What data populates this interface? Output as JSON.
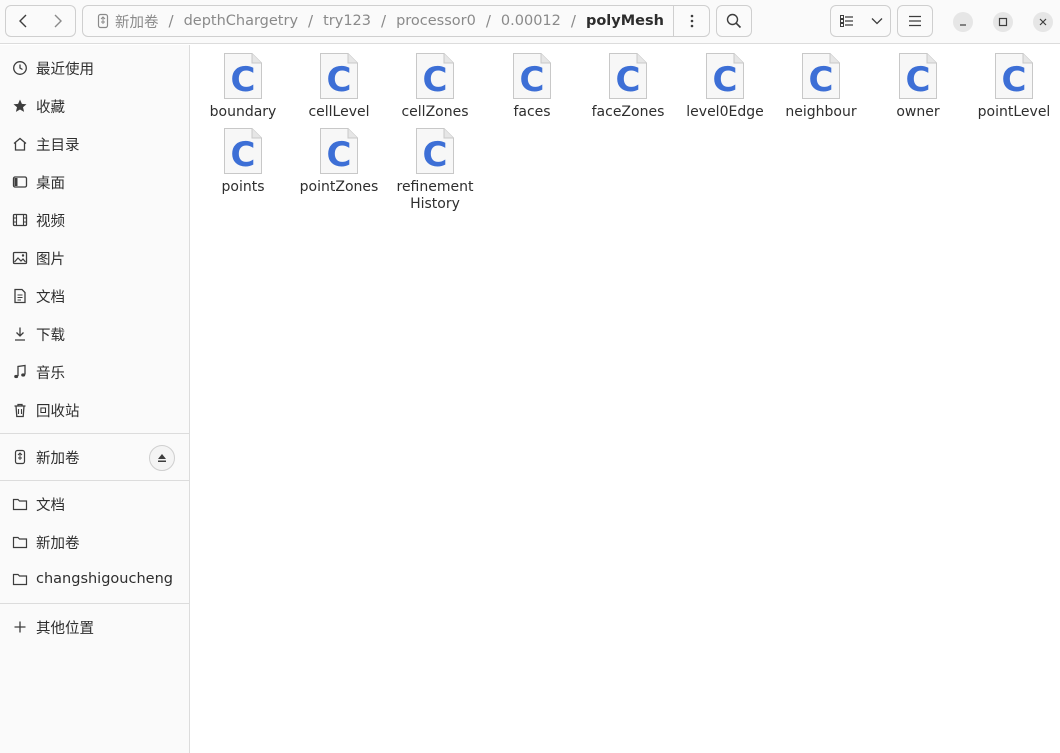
{
  "header": {
    "path": [
      "新加卷",
      "depthChargetry",
      "try123",
      "processor0",
      "0.00012",
      "polyMesh"
    ],
    "path_separator": "/"
  },
  "sidebar": {
    "places": [
      {
        "label": "最近使用",
        "icon": "clock-icon"
      },
      {
        "label": "收藏",
        "icon": "star-icon"
      },
      {
        "label": "主目录",
        "icon": "home-icon"
      },
      {
        "label": "桌面",
        "icon": "desktop-icon"
      },
      {
        "label": "视频",
        "icon": "video-icon"
      },
      {
        "label": "图片",
        "icon": "picture-icon"
      },
      {
        "label": "文档",
        "icon": "document-icon"
      },
      {
        "label": "下载",
        "icon": "download-icon"
      },
      {
        "label": "音乐",
        "icon": "music-icon"
      },
      {
        "label": "回收站",
        "icon": "trash-icon"
      }
    ],
    "devices": [
      {
        "label": "新加卷",
        "icon": "usb-drive-icon"
      }
    ],
    "bookmarks": [
      {
        "label": "文档",
        "icon": "folder-icon"
      },
      {
        "label": "新加卷",
        "icon": "folder-icon"
      },
      {
        "label": "changshigoucheng",
        "icon": "folder-icon"
      }
    ],
    "other": {
      "label": "其他位置",
      "icon": "plus-icon"
    }
  },
  "files": [
    {
      "name_lines": [
        "boundary"
      ]
    },
    {
      "name_lines": [
        "cellLevel"
      ]
    },
    {
      "name_lines": [
        "cellZones"
      ]
    },
    {
      "name_lines": [
        "faces"
      ]
    },
    {
      "name_lines": [
        "faceZones"
      ]
    },
    {
      "name_lines": [
        "level0Edge"
      ]
    },
    {
      "name_lines": [
        "neighbour"
      ]
    },
    {
      "name_lines": [
        "owner"
      ]
    },
    {
      "name_lines": [
        "pointLevel"
      ]
    },
    {
      "name_lines": [
        "points"
      ]
    },
    {
      "name_lines": [
        "pointZones"
      ]
    },
    {
      "name_lines": [
        "refinement",
        "History"
      ]
    }
  ],
  "file_icon_letter": "C",
  "colors": {
    "accent": "#3d6fd6",
    "sidebar_bg": "#fafafa"
  }
}
